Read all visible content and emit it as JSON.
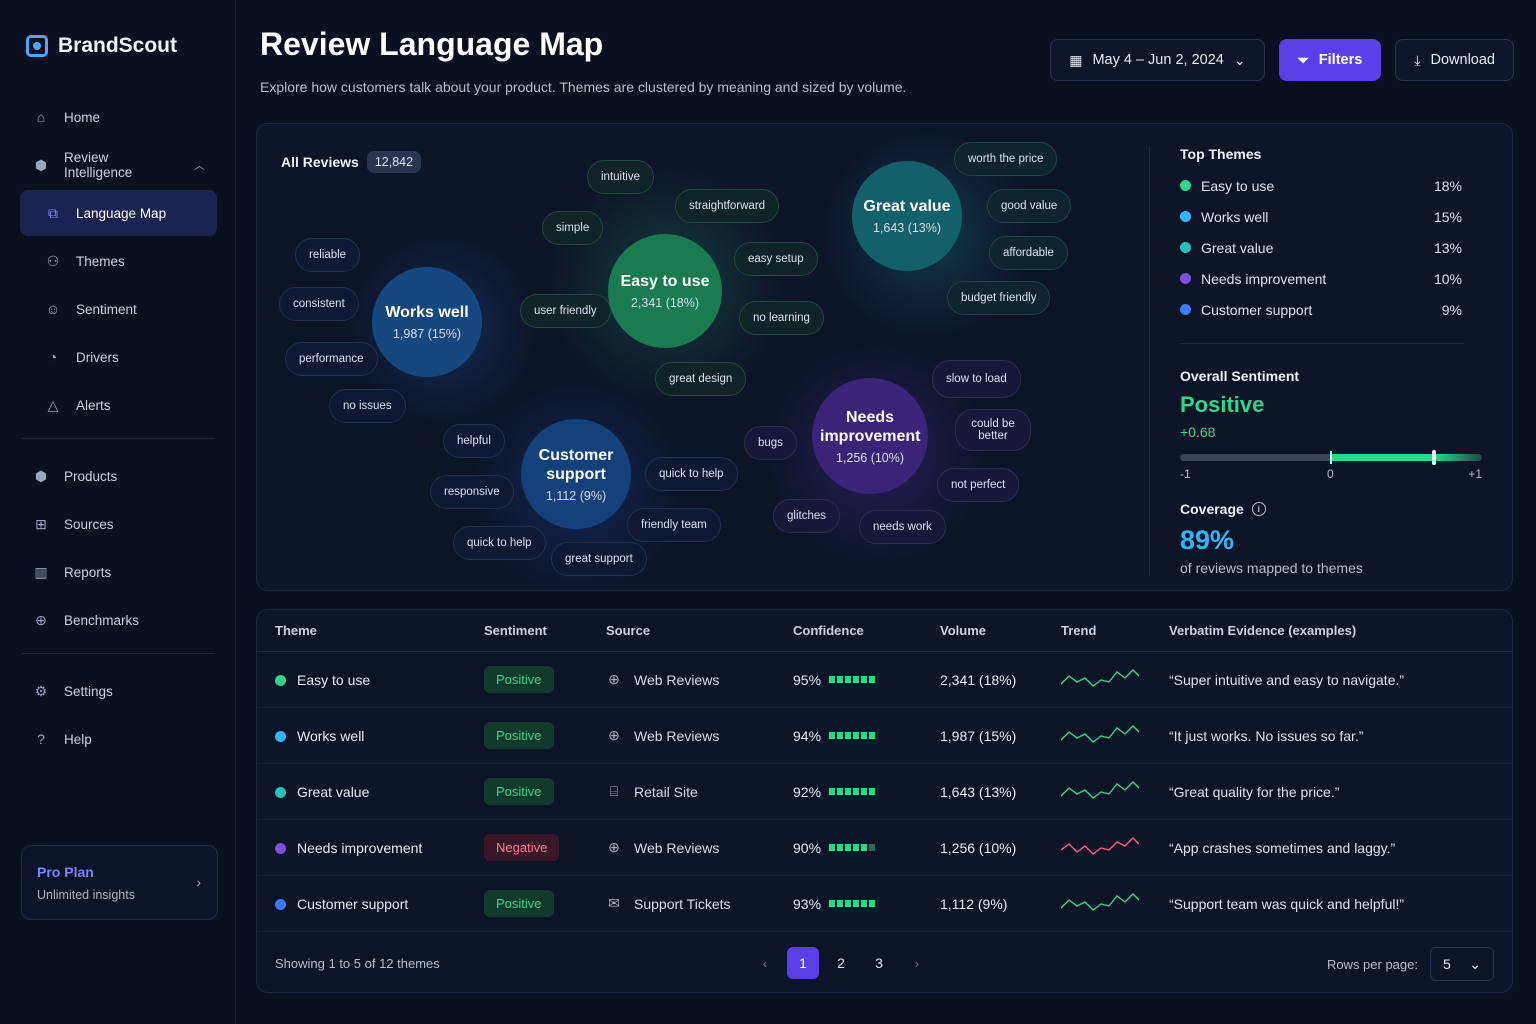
{
  "brand": {
    "name": "BrandScout"
  },
  "sidebar": {
    "items": [
      {
        "label": "Home",
        "icon": "home-icon"
      },
      {
        "label": "Review Intelligence",
        "icon": "cube-icon"
      },
      {
        "label": "Language Map",
        "icon": "map-icon"
      },
      {
        "label": "Themes",
        "icon": "themes-icon"
      },
      {
        "label": "Sentiment",
        "icon": "sentiment-icon"
      },
      {
        "label": "Drivers",
        "icon": "drivers-icon"
      },
      {
        "label": "Alerts",
        "icon": "alert-icon"
      },
      {
        "label": "Products",
        "icon": "products-icon"
      },
      {
        "label": "Sources",
        "icon": "sources-icon"
      },
      {
        "label": "Reports",
        "icon": "reports-icon"
      },
      {
        "label": "Benchmarks",
        "icon": "benchmarks-icon"
      },
      {
        "label": "Settings",
        "icon": "gear-icon"
      },
      {
        "label": "Help",
        "icon": "help-icon"
      }
    ],
    "plan": {
      "title": "Pro Plan",
      "subtitle": "Unlimited insights"
    }
  },
  "header": {
    "title": "Review Language Map",
    "subtitle": "Explore how customers talk about your product. Themes are clustered by meaning and sized by volume.",
    "date_range": "May 4 – Jun 2, 2024",
    "filters_label": "Filters",
    "download_label": "Download"
  },
  "map": {
    "all_reviews_label": "All Reviews",
    "all_reviews_count": "12,842",
    "clusters": {
      "works_well": {
        "name": "Works well",
        "volume": "1,987 (15%)"
      },
      "easy_to_use": {
        "name": "Easy to use",
        "volume": "2,341 (18%)"
      },
      "great_value": {
        "name": "Great value",
        "volume": "1,643 (13%)"
      },
      "customer_support": {
        "name": "Customer support",
        "volume": "1,112 (9%)"
      },
      "needs_improvement": {
        "name": "Needs improvement",
        "volume": "1,256 (10%)"
      }
    },
    "chips": {
      "reliable": "reliable",
      "consistent": "consistent",
      "performance": "performance",
      "no_issues": "no issues",
      "intuitive": "intuitive",
      "straightforward": "straightforward",
      "simple": "simple",
      "user_friendly": "user friendly",
      "easy_setup": "easy setup",
      "no_learning": "no learning",
      "great_design": "great design",
      "worth_price": "worth the price",
      "good_value": "good value",
      "affordable": "affordable",
      "budget_friendly": "budget friendly",
      "helpful": "helpful",
      "responsive": "responsive",
      "quick_help": "quick to help",
      "friendly_team": "friendly team",
      "quick_to_help": "quick to help",
      "great_support": "great support",
      "bugs": "bugs",
      "slow_to_load": "slow to load",
      "could_be_better": "could be better",
      "not_perfect": "not perfect",
      "glitches": "glitches",
      "needs_work": "needs work"
    }
  },
  "top_themes": {
    "title": "Top Themes",
    "items": [
      {
        "name": "Easy to use",
        "pct": "18%",
        "color": "#2fd68c"
      },
      {
        "name": "Works well",
        "pct": "15%",
        "color": "#2fb6ff"
      },
      {
        "name": "Great value",
        "pct": "13%",
        "color": "#22c3b8"
      },
      {
        "name": "Needs improvement",
        "pct": "10%",
        "color": "#7b4fe0"
      },
      {
        "name": "Customer support",
        "pct": "9%",
        "color": "#3a7bff"
      }
    ]
  },
  "sentiment": {
    "title": "Overall Sentiment",
    "value": "Positive",
    "score": "+0.68",
    "score_num": 0.68,
    "min_label": "-1",
    "mid_label": "0",
    "max_label": "+1"
  },
  "coverage": {
    "title": "Coverage",
    "value": "89%",
    "subtitle": "of reviews mapped to themes"
  },
  "table": {
    "headers": [
      "Theme",
      "Sentiment",
      "Source",
      "Confidence",
      "Volume",
      "Trend",
      "Verbatim Evidence (examples)"
    ],
    "rows": [
      {
        "theme": "Easy to use",
        "color": "#2fd68c",
        "sentiment": "Positive",
        "source": "Web Reviews",
        "source_icon": "globe-icon",
        "confidence": "95%",
        "conf_level": 6,
        "volume": "2,341 (18%)",
        "trend_color": "#2fd68c",
        "evidence": "“Super intuitive and easy to navigate.”"
      },
      {
        "theme": "Works well",
        "color": "#2fb6ff",
        "sentiment": "Positive",
        "source": "Web Reviews",
        "source_icon": "globe-icon",
        "confidence": "94%",
        "conf_level": 6,
        "volume": "1,987 (15%)",
        "trend_color": "#2fd68c",
        "evidence": "“It just works. No issues so far.”"
      },
      {
        "theme": "Great value",
        "color": "#22c3b8",
        "sentiment": "Positive",
        "source": "Retail Site",
        "source_icon": "bag-icon",
        "confidence": "92%",
        "conf_level": 6,
        "volume": "1,643 (13%)",
        "trend_color": "#2fd68c",
        "evidence": "“Great quality for the price.”"
      },
      {
        "theme": "Needs improvement",
        "color": "#7b4fe0",
        "sentiment": "Negative",
        "source": "Web Reviews",
        "source_icon": "globe-icon",
        "confidence": "90%",
        "conf_level": 5,
        "volume": "1,256 (10%)",
        "trend_color": "#ff5a8a",
        "evidence": "“App crashes sometimes and laggy.”"
      },
      {
        "theme": "Customer support",
        "color": "#3a7bff",
        "sentiment": "Positive",
        "source": "Support Tickets",
        "source_icon": "mail-icon",
        "confidence": "93%",
        "conf_level": 6,
        "volume": "1,112 (9%)",
        "trend_color": "#2fd68c",
        "evidence": "“Support team was quick and helpful!”"
      }
    ],
    "footer": {
      "showing": "Showing 1 to 5 of 12 themes",
      "pages": [
        "1",
        "2",
        "3"
      ],
      "rows_per_page_label": "Rows per page:",
      "rows_per_page_value": "5"
    }
  }
}
